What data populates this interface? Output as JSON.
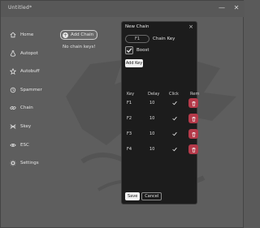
{
  "window": {
    "title": "Untitled*",
    "minimize": "—",
    "close": "✕"
  },
  "sidebar": {
    "items": [
      {
        "label": "Home",
        "icon": "home-icon"
      },
      {
        "label": "Autopot",
        "icon": "potion-icon"
      },
      {
        "label": "Autobuff",
        "icon": "buff-icon"
      },
      {
        "label": "Spammer",
        "icon": "spammer-icon"
      },
      {
        "label": "Chain",
        "icon": "chain-icon"
      },
      {
        "label": "Skey",
        "icon": "skey-icon"
      },
      {
        "label": "ESC",
        "icon": "eye-icon"
      },
      {
        "label": "Settings",
        "icon": "gear-icon"
      }
    ]
  },
  "main": {
    "add_button": "Add Chain",
    "empty_text": "No chain keys!"
  },
  "dialog": {
    "title": "New Chain",
    "close": "×",
    "key_input": "F1",
    "key_label": "Chain Key",
    "boost_label": "Boost",
    "boost_checked": true,
    "add_key_button": "Add Key",
    "columns": [
      "Key",
      "Delay",
      "Click",
      "Rem"
    ],
    "rows": [
      {
        "key": "F1",
        "delay": "10",
        "click": true
      },
      {
        "key": "F2",
        "delay": "10",
        "click": true
      },
      {
        "key": "F3",
        "delay": "10",
        "click": true
      },
      {
        "key": "F4",
        "delay": "10",
        "click": true
      }
    ],
    "save_button": "Save",
    "cancel_button": "Cancel"
  },
  "colors": {
    "delete_button": "#b53a4a",
    "dialog_bg": "#1c1c1c",
    "window_bg": "#5e5e5e"
  }
}
